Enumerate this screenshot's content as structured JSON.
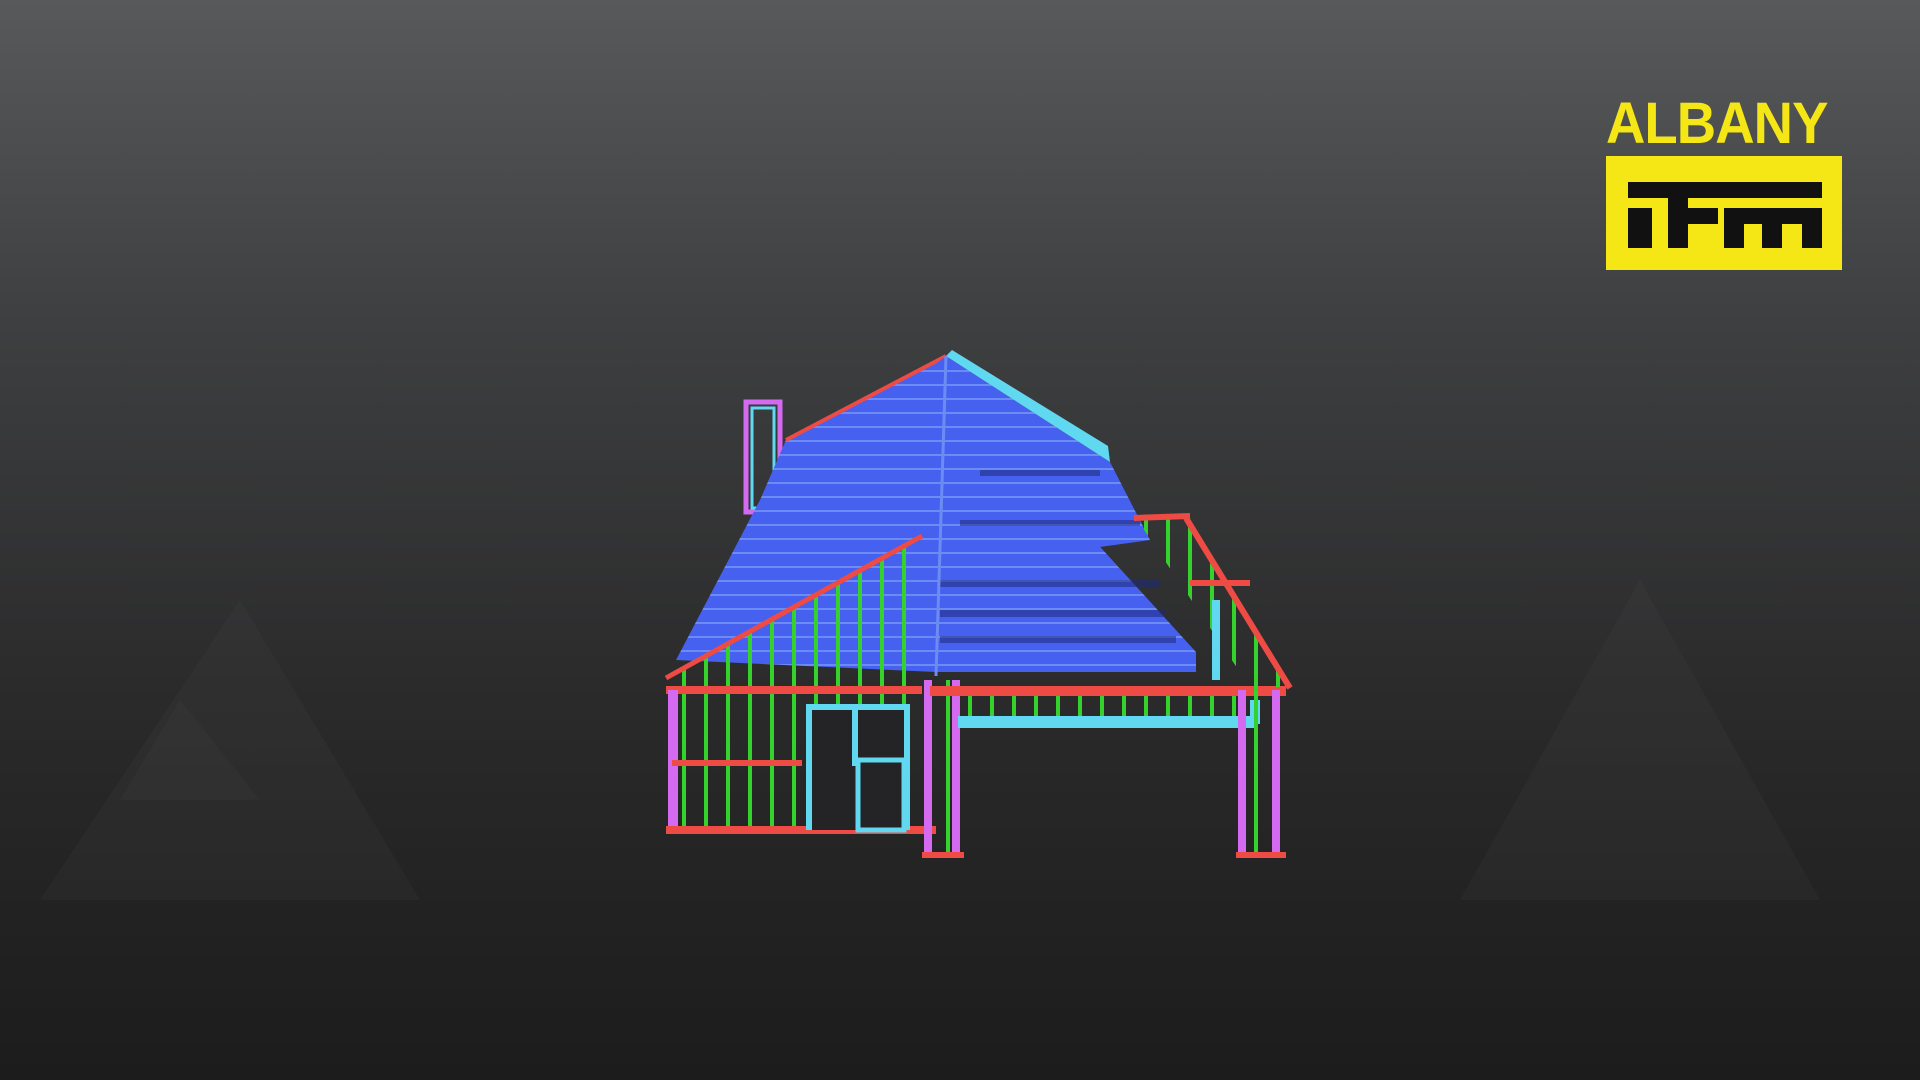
{
  "scene": {
    "background_top": "#58595b",
    "background_bottom": "#1c1c1c",
    "model": "house-frame-wireframe"
  },
  "colors": {
    "roof": "#4660f0",
    "roof_light": "#6c8cf4",
    "stud": "#35d12c",
    "plate": "#ee4b44",
    "jamb": "#5fd8f0",
    "post": "#d36af0",
    "accent": "#f5e615"
  },
  "logo": {
    "word": "ALBANY",
    "mark": "itm"
  }
}
